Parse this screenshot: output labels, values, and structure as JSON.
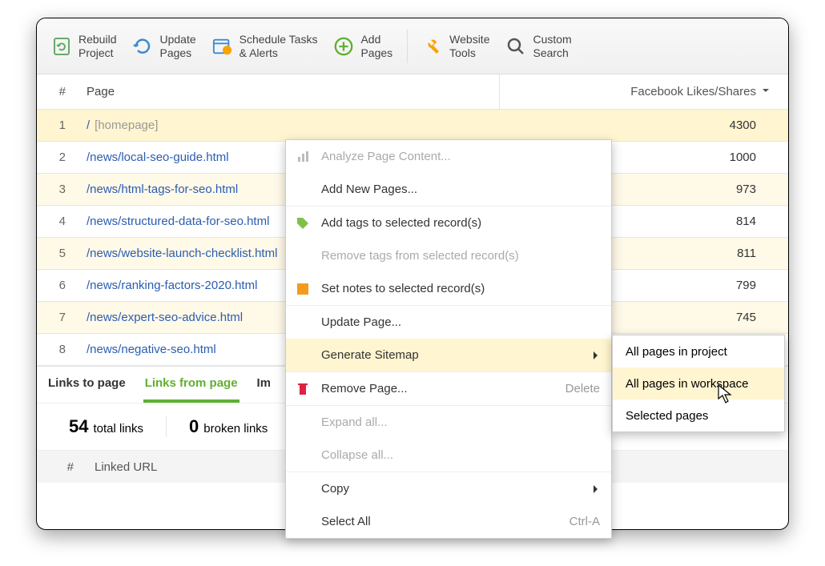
{
  "toolbar": [
    {
      "label": "Rebuild\nProject",
      "icon": "rebuild"
    },
    {
      "label": "Update\nPages",
      "icon": "update"
    },
    {
      "label": "Schedule Tasks\n& Alerts",
      "icon": "schedule"
    },
    {
      "label": "Add\nPages",
      "icon": "add"
    },
    {
      "label": "Website\nTools",
      "icon": "tools"
    },
    {
      "label": "Custom\nSearch",
      "icon": "search"
    }
  ],
  "grid": {
    "header": {
      "num": "#",
      "page": "Page",
      "fb": "Facebook Likes/Shares"
    },
    "rows": [
      {
        "n": "1",
        "url": "/",
        "note": "[homepage]",
        "fb": "4300"
      },
      {
        "n": "2",
        "url": "/news/local-seo-guide.html",
        "fb": "1000"
      },
      {
        "n": "3",
        "url": "/news/html-tags-for-seo.html",
        "fb": "973"
      },
      {
        "n": "4",
        "url": "/news/structured-data-for-seo.html",
        "fb": "814"
      },
      {
        "n": "5",
        "url": "/news/website-launch-checklist.html",
        "fb": "811"
      },
      {
        "n": "6",
        "url": "/news/ranking-factors-2020.html",
        "fb": "799"
      },
      {
        "n": "7",
        "url": "/news/expert-seo-advice.html",
        "fb": "745"
      },
      {
        "n": "8",
        "url": "/news/negative-seo.html",
        "fb": ""
      }
    ]
  },
  "tabs": {
    "links_to": "Links to page",
    "links_from": "Links from page",
    "images": "Images"
  },
  "summary": {
    "total_n": "54",
    "total_lbl": "total links",
    "broken_n": "0",
    "broken_lbl": "broken links"
  },
  "subhead": {
    "num": "#",
    "linked": "Linked URL"
  },
  "ctx": {
    "analyze": "Analyze Page Content...",
    "addnew": "Add New Pages...",
    "addtags": "Add tags to selected record(s)",
    "removetags": "Remove tags from selected record(s)",
    "setnotes": "Set notes to selected record(s)",
    "update": "Update Page...",
    "sitemap": "Generate Sitemap",
    "remove": "Remove Page...",
    "remove_sc": "Delete",
    "expand": "Expand all...",
    "collapse": "Collapse all...",
    "copy": "Copy",
    "selectall": "Select All",
    "selectall_sc": "Ctrl-A"
  },
  "submenu": {
    "all_project": "All pages in project",
    "all_workspace": "All pages in workspace",
    "selected": "Selected pages"
  }
}
